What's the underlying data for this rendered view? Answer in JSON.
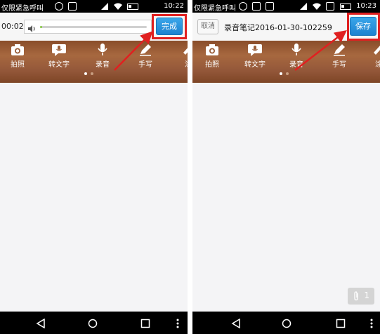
{
  "left_screen": {
    "status": {
      "carrier": "仅限紧急呼叫",
      "time": "10:22"
    },
    "recorder": {
      "elapsed": "00:02",
      "progress": 0.02,
      "done_label": "完成"
    },
    "toolbar": {
      "items": [
        {
          "label": "拍照",
          "icon": "camera-icon"
        },
        {
          "label": "转文字",
          "icon": "speech-to-text-icon"
        },
        {
          "label": "录音",
          "icon": "microphone-icon"
        },
        {
          "label": "手写",
          "icon": "pencil-icon"
        },
        {
          "label": "涂",
          "icon": "brush-icon"
        }
      ]
    },
    "pager": {
      "pages": 2,
      "active": 1
    }
  },
  "right_screen": {
    "status": {
      "carrier": "仅限紧急呼叫",
      "time": "10:23"
    },
    "header": {
      "cancel_label": "取消",
      "title": "录音笔记2016-01-30-102259",
      "save_label": "保存"
    },
    "toolbar": {
      "items": [
        {
          "label": "拍照",
          "icon": "camera-icon"
        },
        {
          "label": "转文字",
          "icon": "speech-to-text-icon"
        },
        {
          "label": "录音",
          "icon": "microphone-icon"
        },
        {
          "label": "手写",
          "icon": "pencil-icon"
        },
        {
          "label": "涂",
          "icon": "brush-icon"
        }
      ]
    },
    "pager": {
      "pages": 2,
      "active": 1
    },
    "attachment": {
      "count": "1"
    }
  },
  "colors": {
    "highlight": "#e02020",
    "toolbar_wood": "#9a5d38",
    "button_blue": "#2a94dd",
    "progress": "#88cc44"
  }
}
